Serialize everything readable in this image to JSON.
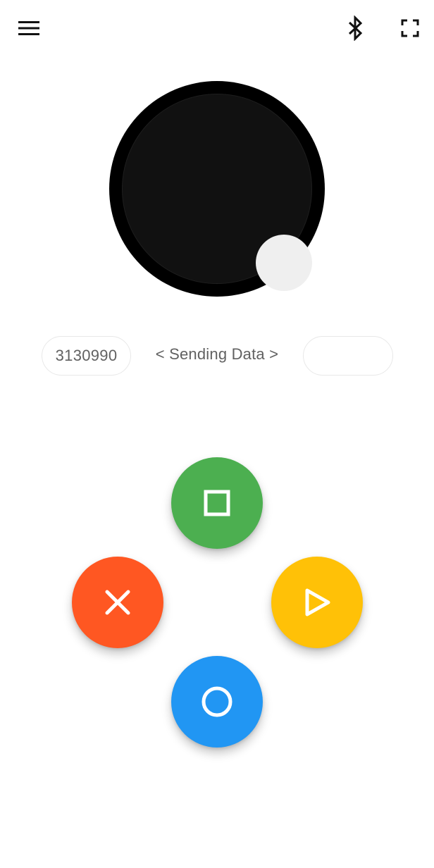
{
  "toolbar": {
    "menu_icon": "menu-icon",
    "bluetooth_icon": "bluetooth-icon",
    "fullscreen_icon": "fullscreen-icon"
  },
  "joystick": {
    "base_color": "#000000",
    "knob_color": "#efefef"
  },
  "data_row": {
    "left_value": "3130990",
    "status": "< Sending Data >",
    "right_value": ""
  },
  "buttons": {
    "square": {
      "icon": "square-icon",
      "color": "#4CAF50"
    },
    "cross": {
      "icon": "cross-icon",
      "color": "#FF5722"
    },
    "triangle": {
      "icon": "triangle-icon",
      "color": "#FFC107"
    },
    "circle": {
      "icon": "circle-icon",
      "color": "#2196F3"
    }
  }
}
